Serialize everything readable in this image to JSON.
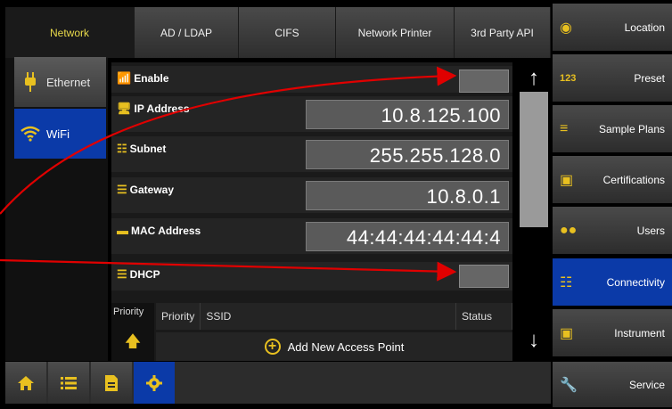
{
  "tabs": [
    {
      "label": "Network",
      "active": true
    },
    {
      "label": "AD / LDAP"
    },
    {
      "label": "CIFS"
    },
    {
      "label": "Network Printer"
    },
    {
      "label": "3rd Party API"
    }
  ],
  "sidebar": {
    "items": [
      {
        "label": "Ethernet",
        "icon": "ethernet-plug-icon"
      },
      {
        "label": "WiFi",
        "icon": "wifi-icon",
        "active": true
      }
    ]
  },
  "fields": {
    "enable": {
      "label": "Enable",
      "icon": "wifi-icon"
    },
    "ip": {
      "label": "IP Address",
      "value": "10.8.125.100",
      "icon": "ip-icon"
    },
    "subnet": {
      "label": "Subnet",
      "value": "255.255.128.0",
      "icon": "network-icon"
    },
    "gateway": {
      "label": "Gateway",
      "value": "10.8.0.1",
      "icon": "gateway-icon"
    },
    "mac": {
      "label": "MAC Address",
      "value": "44:44:44:44:44:4",
      "icon": "mac-icon"
    },
    "dhcp": {
      "label": "DHCP",
      "icon": "dhcp-icon"
    }
  },
  "access_points": {
    "side_label": "Priority",
    "columns": [
      "Priority",
      "SSID",
      "Status"
    ],
    "add_label": "Add New Access Point"
  },
  "right_menu": [
    {
      "label": "Location",
      "icon": "location-pin-icon"
    },
    {
      "label": "Preset",
      "icon": "preset-123-icon"
    },
    {
      "label": "Sample Plans",
      "icon": "list-icon"
    },
    {
      "label": "Certifications",
      "icon": "certificate-icon"
    },
    {
      "label": "Users",
      "icon": "users-icon"
    },
    {
      "label": "Connectivity",
      "icon": "network-icon",
      "active": true
    },
    {
      "label": "Instrument",
      "icon": "instrument-icon"
    },
    {
      "label": "Service",
      "icon": "wrench-icon"
    }
  ],
  "bottom_bar": [
    {
      "icon": "home-icon"
    },
    {
      "icon": "list-icon"
    },
    {
      "icon": "document-icon"
    },
    {
      "icon": "settings-gear-icon",
      "active": true
    }
  ],
  "colors": {
    "accent_yellow": "#e8c020",
    "active_blue": "#0b3aa8",
    "annotation_red": "#e00000"
  }
}
